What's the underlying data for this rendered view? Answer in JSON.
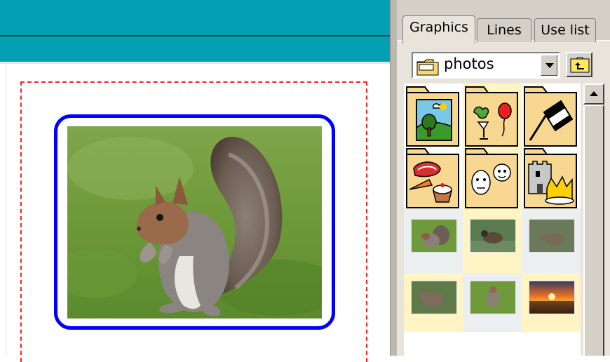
{
  "panel": {
    "tabs": [
      {
        "label": "Graphics",
        "active": true
      },
      {
        "label": "Lines",
        "active": false
      },
      {
        "label": "Use list",
        "active": false
      }
    ],
    "folder_select": {
      "value": "photos"
    },
    "folders": [
      {
        "icon": "landscape-folder-icon"
      },
      {
        "icon": "party-folder-icon"
      },
      {
        "icon": "racing-flag-folder-icon"
      },
      {
        "icon": "food-folder-icon"
      },
      {
        "icon": "faces-folder-icon"
      },
      {
        "icon": "castle-crown-folder-icon"
      }
    ],
    "photos": [
      {
        "icon": "squirrel-photo-thumbnail"
      },
      {
        "icon": "duck-photo-thumbnail"
      },
      {
        "icon": "hare-photo-thumbnail"
      },
      {
        "icon": "rabbit-photo-thumbnail"
      },
      {
        "icon": "squirrel-photo-thumbnail"
      },
      {
        "icon": "sunset-photo-thumbnail"
      }
    ]
  },
  "colors": {
    "top_bar": "#03a0b4",
    "frame": "#0000ff",
    "page_border": "#ff2020",
    "folder": "#f8d890",
    "highlight": "#fff5c8"
  }
}
